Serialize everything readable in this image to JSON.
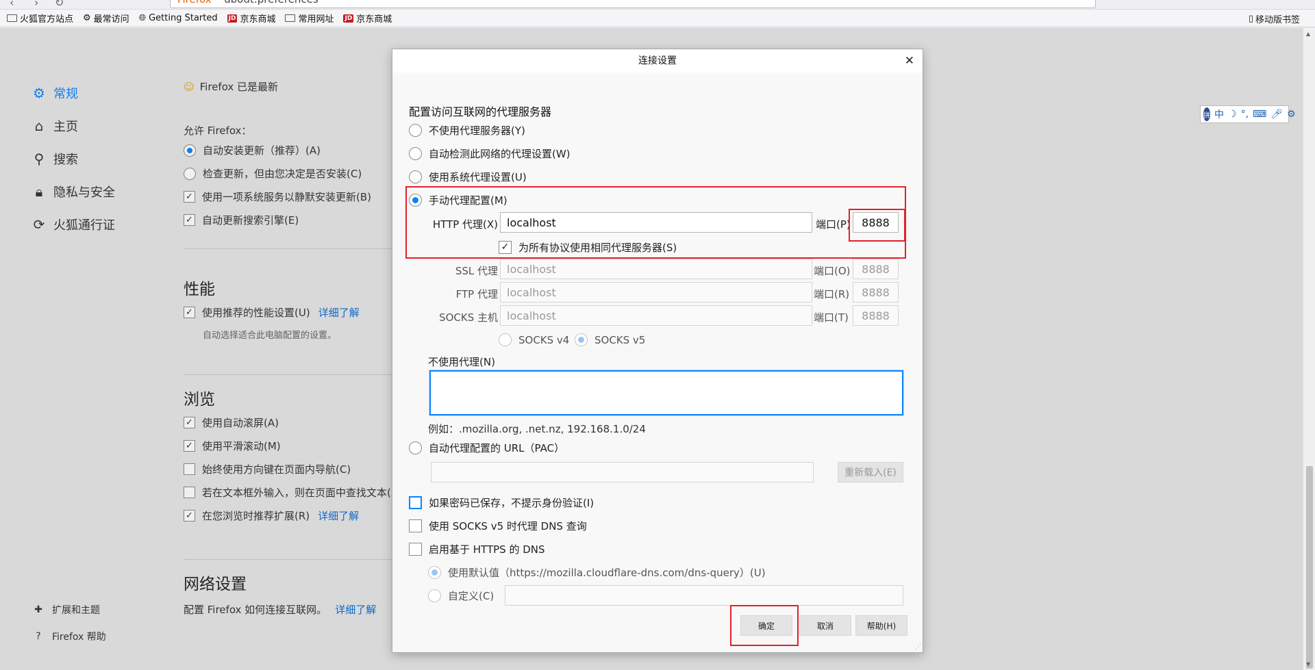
{
  "urlbar": {
    "scheme": "Firefox",
    "url": "about:preferences"
  },
  "bookmarks": [
    {
      "label": "火狐官方站点",
      "icon": "folder-icon"
    },
    {
      "label": "最常访问",
      "icon": "gear-icon"
    },
    {
      "label": "Getting Started",
      "icon": "globe-icon"
    },
    {
      "label": "京东商城",
      "icon": "jd-icon"
    },
    {
      "label": "常用网址",
      "icon": "folder-icon"
    },
    {
      "label": "京东商城",
      "icon": "jd-icon"
    }
  ],
  "bookmarks_right": "移动版书签",
  "sidebar": {
    "items": [
      {
        "label": "常规",
        "icon": "gear-icon"
      },
      {
        "label": "主页",
        "icon": "home-icon"
      },
      {
        "label": "搜索",
        "icon": "search-icon"
      },
      {
        "label": "隐私与安全",
        "icon": "lock-icon"
      },
      {
        "label": "火狐通行证",
        "icon": "sync-icon"
      }
    ],
    "footer": [
      {
        "label": "扩展和主题",
        "icon": "puzzle-icon"
      },
      {
        "label": "Firefox 帮助",
        "icon": "help-icon"
      }
    ]
  },
  "prefs": {
    "firefox_status": "Firefox 已是最新",
    "allow_label": "允许 Firefox：",
    "update_auto": "自动安装更新（推荐）(A)",
    "update_check": "检查更新，但由您决定是否安装(C)",
    "bg_service": "使用一项系统服务以静默安装更新(B)",
    "search_engines": "自动更新搜索引擎(E)",
    "perf_heading": "性能",
    "perf_recommended": "使用推荐的性能设置(U)",
    "learn_more": "详细了解",
    "perf_note": "自动选择适合此电脑配置的设置。",
    "browse_heading": "浏览",
    "autoscroll": "使用自动滚屏(A)",
    "smooth_scroll": "使用平滑滚动(M)",
    "cursor_keys": "始终使用方向键在页面内导航(C)",
    "find_typing": "若在文本框外输入，则在页面中查找文本(X)",
    "recommend_ext": "在您浏览时推荐扩展(R)",
    "network_heading": "网络设置",
    "network_desc": "配置 Firefox 如何连接互联网。"
  },
  "dialog": {
    "title": "连接设置",
    "section": "配置访问互联网的代理服务器",
    "no_proxy": "不使用代理服务器(Y)",
    "auto_detect": "自动检测此网络的代理设置(W)",
    "system_proxy": "使用系统代理设置(U)",
    "manual": "手动代理配置(M)",
    "http_label": "HTTP 代理(X)",
    "http_value": "localhost",
    "http_port_label": "端口(P)",
    "http_port": "8888",
    "share_all": "为所有协议使用相同代理服务器(S)",
    "ssl_label": "SSL 代理",
    "ssl_value": "localhost",
    "ssl_port_label": "端口(O)",
    "ssl_port": "8888",
    "ftp_label": "FTP 代理",
    "ftp_value": "localhost",
    "ftp_port_label": "端口(R)",
    "ftp_port": "8888",
    "socks_label": "SOCKS 主机",
    "socks_value": "localhost",
    "socks_port_label": "端口(T)",
    "socks_port": "8888",
    "socks_v4": "SOCKS v4",
    "socks_v5": "SOCKS v5",
    "no_proxy_for_label": "不使用代理(N)",
    "no_proxy_for_value": "",
    "example": "例如：.mozilla.org, .net.nz, 192.168.1.0/24",
    "pac_label": "自动代理配置的 URL（PAC）",
    "pac_value": "",
    "reload": "重新载入(E)",
    "no_auth_prompt": "如果密码已保存，不提示身份验证(I)",
    "socks_dns": "使用 SOCKS v5 时代理 DNS 查询",
    "https_dns": "启用基于 HTTPS 的 DNS",
    "default_dns": "使用默认值（https://mozilla.cloudflare-dns.com/dns-query）(U)",
    "custom_dns": "自定义(C)",
    "custom_dns_value": "",
    "ok": "确定",
    "cancel": "取消",
    "help": "帮助(H)"
  },
  "ime": {
    "mode": "中"
  }
}
